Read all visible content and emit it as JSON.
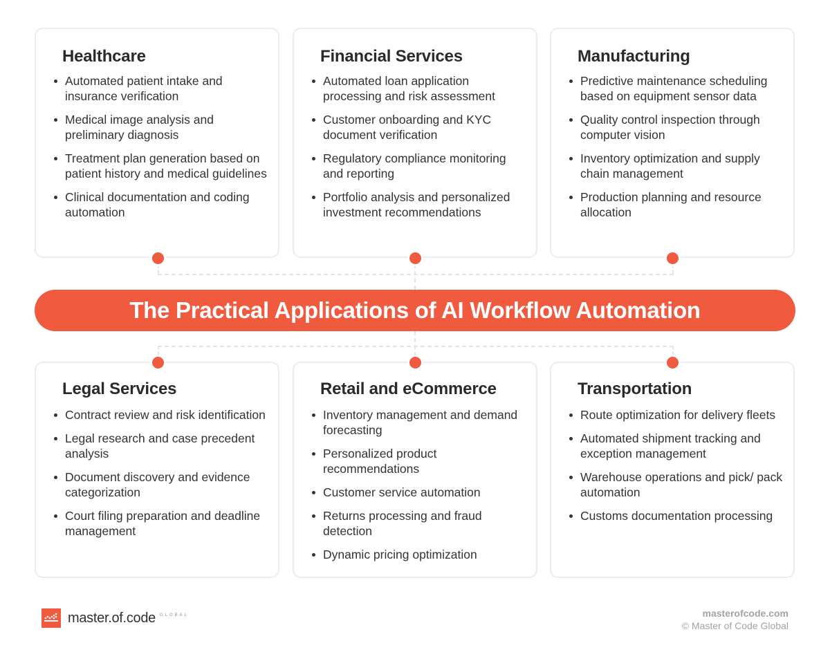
{
  "title": "The Practical Applications of AI Workflow Automation",
  "accent_color": "#f05a3f",
  "cards": [
    {
      "title": "Healthcare",
      "items": [
        "Automated patient intake and insurance verification",
        "Medical image analysis and preliminary diagnosis",
        "Treatment plan generation based on patient history and medical guidelines",
        "Clinical documentation and coding automation"
      ]
    },
    {
      "title": "Financial Services",
      "items": [
        "Automated loan application processing and risk assessment",
        "Customer onboarding and KYC document verification",
        "Regulatory compliance monitoring and reporting",
        "Portfolio analysis and personalized investment recommendations"
      ]
    },
    {
      "title": "Manufacturing",
      "items": [
        "Predictive maintenance scheduling based on equipment sensor data",
        "Quality control inspection through computer vision",
        "Inventory optimization and supply chain management",
        "Production planning and resource allocation"
      ]
    },
    {
      "title": "Legal Services",
      "items": [
        "Contract review and risk identification",
        "Legal research and case precedent analysis",
        "Document discovery and evidence categorization",
        "Court filing preparation and deadline management"
      ]
    },
    {
      "title": "Retail and eCommerce",
      "items": [
        "Inventory management and demand forecasting",
        "Personalized product recommendations",
        "Customer service automation",
        "Returns processing and fraud detection",
        "Dynamic pricing optimization"
      ]
    },
    {
      "title": "Transportation",
      "items": [
        "Route optimization for delivery fleets",
        "Automated shipment tracking and exception management",
        "Warehouse operations and pick/ pack automation",
        "Customs documentation processing"
      ]
    }
  ],
  "footer": {
    "logo_text": "master.of.code",
    "logo_sub": "GLOBAL",
    "site": "masterofcode.com",
    "copyright": "© Master of Code Global"
  }
}
